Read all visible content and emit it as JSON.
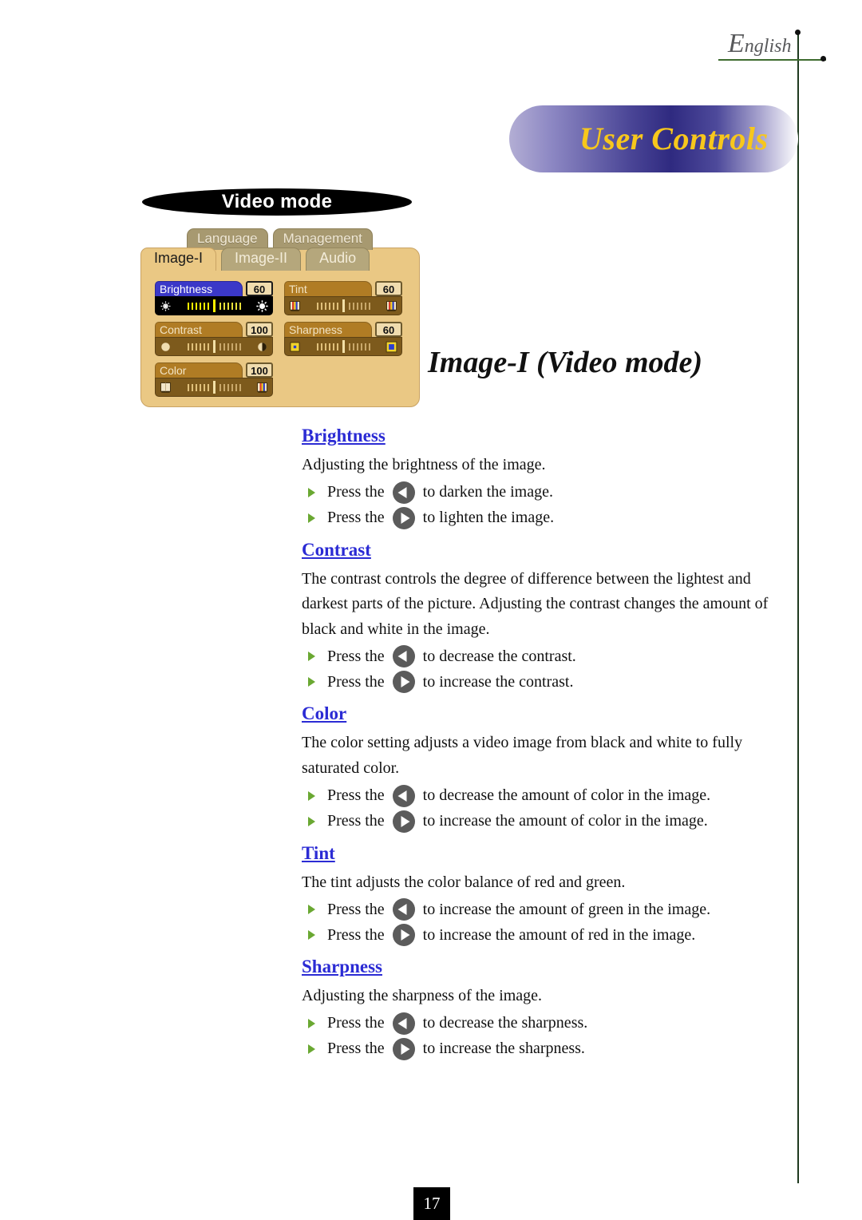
{
  "header": {
    "language_label_cap": "E",
    "language_label_rest": "nglish",
    "banner_title": "User Controls"
  },
  "osd": {
    "caption": "Video mode",
    "top_tabs": [
      {
        "label": "Language"
      },
      {
        "label": "Management"
      }
    ],
    "bottom_tabs": [
      {
        "label": "Image-I",
        "active": true
      },
      {
        "label": "Image-II",
        "active": false
      },
      {
        "label": "Audio",
        "active": false
      }
    ],
    "controls": [
      {
        "label": "Brightness",
        "value": "60",
        "selected": true,
        "icon_left": "sun-small-icon",
        "icon_right": "sun-large-icon"
      },
      {
        "label": "Tint",
        "value": "60",
        "selected": false,
        "icon_left": "color-bar-icon",
        "icon_right": "color-bar-icon"
      },
      {
        "label": "Contrast",
        "value": "100",
        "selected": false,
        "icon_left": "circle-light-icon",
        "icon_right": "circle-half-icon"
      },
      {
        "label": "Sharpness",
        "value": "60",
        "selected": false,
        "icon_left": "square-small-icon",
        "icon_right": "square-large-icon"
      },
      {
        "label": "Color",
        "value": "100",
        "selected": false,
        "icon_left": "book-pale-icon",
        "icon_right": "book-color-icon"
      }
    ]
  },
  "page": {
    "heading": "Image-I (Video mode)",
    "number": "17"
  },
  "sections": [
    {
      "title": "Brightness",
      "paragraphs": [
        "Adjusting the brightness of the image."
      ],
      "bullets": [
        {
          "pre": "Press the",
          "arrow": "left",
          "post": "to darken the image."
        },
        {
          "pre": "Press the",
          "arrow": "right",
          "post": "to lighten the image."
        }
      ]
    },
    {
      "title": "Contrast",
      "paragraphs": [
        "The contrast controls the degree of difference between the lightest and darkest parts of  the picture. Adjusting  the contrast changes the amount of black and white in the image."
      ],
      "bullets": [
        {
          "pre": "Press the",
          "arrow": "left",
          "post": "to decrease the contrast."
        },
        {
          "pre": "Press the",
          "arrow": "right",
          "post": "to increase the contrast."
        }
      ]
    },
    {
      "title": "Color",
      "paragraphs": [
        "The color setting adjusts a video image from black and white to fully saturated color."
      ],
      "bullets": [
        {
          "pre": "Press the",
          "arrow": "left",
          "post": "to decrease the amount of color in the image."
        },
        {
          "pre": "Press the",
          "arrow": "right",
          "post": "to increase the amount of color in the image."
        }
      ]
    },
    {
      "title": "Tint",
      "paragraphs": [
        "The tint adjusts the color balance of red and green."
      ],
      "bullets": [
        {
          "pre": "Press the",
          "arrow": "left",
          "post": "to increase the amount of green in the image."
        },
        {
          "pre": "Press the",
          "arrow": "right",
          "post": "to increase the amount of red  in the image."
        }
      ]
    },
    {
      "title": "Sharpness",
      "paragraphs": [
        "Adjusting the sharpness of the image."
      ],
      "bullets": [
        {
          "pre": "Press the",
          "arrow": "left",
          "post": "to decrease the sharpness."
        },
        {
          "pre": "Press the",
          "arrow": "right",
          "post": "to increase the sharpness."
        }
      ]
    }
  ],
  "colors": {
    "heading_blue": "#2b2bd4",
    "banner_yellow": "#f7c71c",
    "osd_panel": "#eac884",
    "osd_selected": "#3b38c8",
    "rule_green": "#3d6b2e"
  }
}
